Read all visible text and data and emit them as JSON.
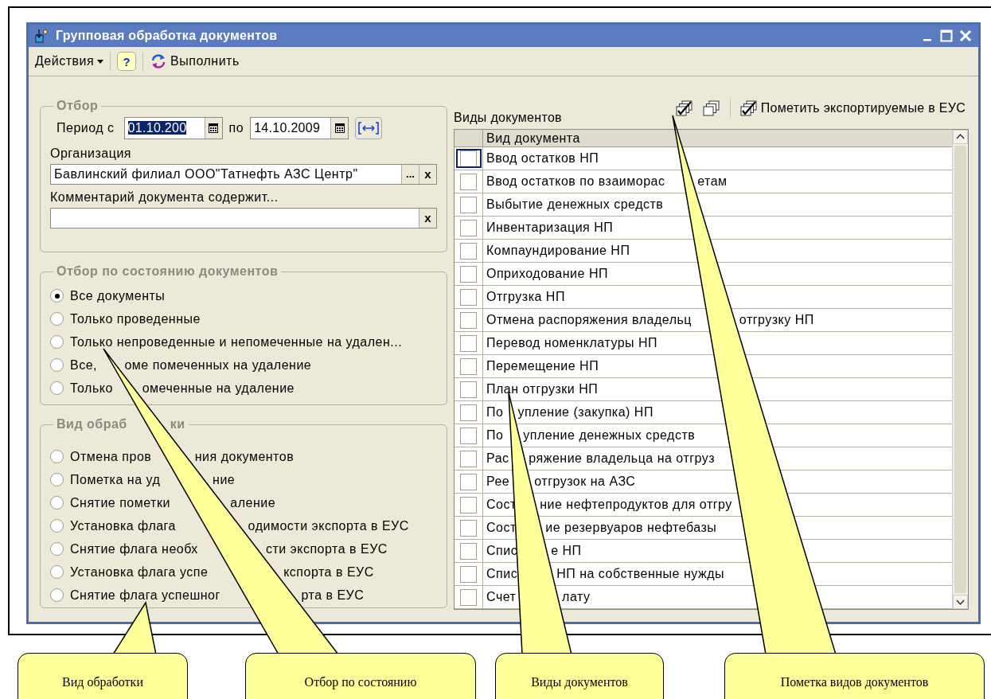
{
  "window": {
    "title": "Групповая обработка документов"
  },
  "toolbar": {
    "actions": "Действия",
    "help": "?",
    "execute": "Выполнить"
  },
  "filter": {
    "legend": "Отбор",
    "period_label": "Период с",
    "date_from": {
      "value": "01.10.200",
      "selected": true
    },
    "to_label": "по",
    "date_to": {
      "value": "14.10.2009",
      "selected": false
    },
    "organization_label": "Организация",
    "organization": "Бавлинский филиал ООО\"Татнефть АЗС Центр\"",
    "organization_choose": "...",
    "organization_clear": "x",
    "comment_label": "Комментарий документа содержит...",
    "comment_clear": "x"
  },
  "state_filter": {
    "legend": "Отбор по состоянию документов",
    "options": [
      {
        "label": "Все документы",
        "selected": true
      },
      {
        "label": "Только проведенные",
        "selected": false
      },
      {
        "label": "Только непроведенные и непомеченные на удален...",
        "selected": false
      },
      {
        "label": [
          "Все,",
          "оме помеченных на удаление"
        ],
        "selected": false
      },
      {
        "label": [
          "Только",
          "омеченные на удаление"
        ],
        "selected": false
      }
    ]
  },
  "processing": {
    "legend": [
      "Вид обраб",
      "ки"
    ],
    "options": [
      {
        "label": [
          "Отмена пров",
          "ния документов"
        ],
        "selected": false
      },
      {
        "label": [
          "Пометка на уд",
          "ние"
        ],
        "selected": false
      },
      {
        "label": [
          "Снятие пометки",
          "аление"
        ],
        "selected": false
      },
      {
        "label": [
          "Установка флага",
          "одимости экспорта в ЕУС"
        ],
        "selected": false
      },
      {
        "label": [
          "Снятие флага необх",
          "сти экспорта в ЕУС"
        ],
        "selected": false
      },
      {
        "label": [
          "Установка флага успе",
          "кспорта в ЕУС"
        ],
        "selected": false
      },
      {
        "label": [
          "Снятие флага успешног",
          "рта в ЕУС"
        ],
        "selected": false
      }
    ]
  },
  "doc_types": {
    "title": "Виды документов",
    "tools": [
      {
        "kind": "check_all"
      },
      {
        "kind": "uncheck_all"
      },
      {
        "kind": "mark_export",
        "label": "Пометить экспортируемые в ЕУС"
      }
    ],
    "column": "Вид документа",
    "rows": [
      {
        "name": "Ввод остатков НП",
        "checked": false,
        "current": true
      },
      {
        "name": [
          "Ввод остатков по взаиморас",
          "етам"
        ],
        "checked": false,
        "current": false
      },
      {
        "name": "Выбытие денежных средств",
        "checked": false,
        "current": false
      },
      {
        "name": "Инвентаризация НП",
        "checked": false,
        "current": false
      },
      {
        "name": "Компаундирование НП",
        "checked": false,
        "current": false
      },
      {
        "name": "Оприходование НП",
        "checked": false,
        "current": false
      },
      {
        "name": "Отгрузка НП",
        "checked": false,
        "current": false
      },
      {
        "name": [
          "Отмена распоряжения владельц",
          "отгрузку НП"
        ],
        "checked": false,
        "current": false
      },
      {
        "name": "Перевод номенклатуры НП",
        "checked": false,
        "current": false
      },
      {
        "name": "Перемещение НП",
        "checked": false,
        "current": false
      },
      {
        "name": "План отгрузки НП",
        "checked": false,
        "current": false
      },
      {
        "name": [
          "По",
          "упление (закупка) НП"
        ],
        "checked": false,
        "current": false
      },
      {
        "name": [
          "По",
          "упление денежных средств"
        ],
        "checked": false,
        "current": false
      },
      {
        "name": [
          "Рас",
          "ряжение владельца на отгруз"
        ],
        "checked": false,
        "current": false
      },
      {
        "name": [
          "Рее",
          "отгрузок на АЗС"
        ],
        "checked": false,
        "current": false
      },
      {
        "name": [
          "Сост",
          "ние нефтепродуктов для отгру"
        ],
        "checked": false,
        "current": false
      },
      {
        "name": [
          "Сост",
          "ие резервуаров нефтебазы"
        ],
        "checked": false,
        "current": false
      },
      {
        "name": [
          "Спис",
          "е НП"
        ],
        "checked": false,
        "current": false
      },
      {
        "name": [
          "Спис",
          "НП на собственные нужды"
        ],
        "checked": false,
        "current": false
      },
      {
        "name": [
          "Счет",
          "лату"
        ],
        "checked": false,
        "current": false
      }
    ]
  },
  "callouts": [
    {
      "label": "Вид обработки"
    },
    {
      "label": "Отбор по состоянию"
    },
    {
      "label": "Виды документов"
    },
    {
      "label": "Пометка видов документов"
    }
  ]
}
